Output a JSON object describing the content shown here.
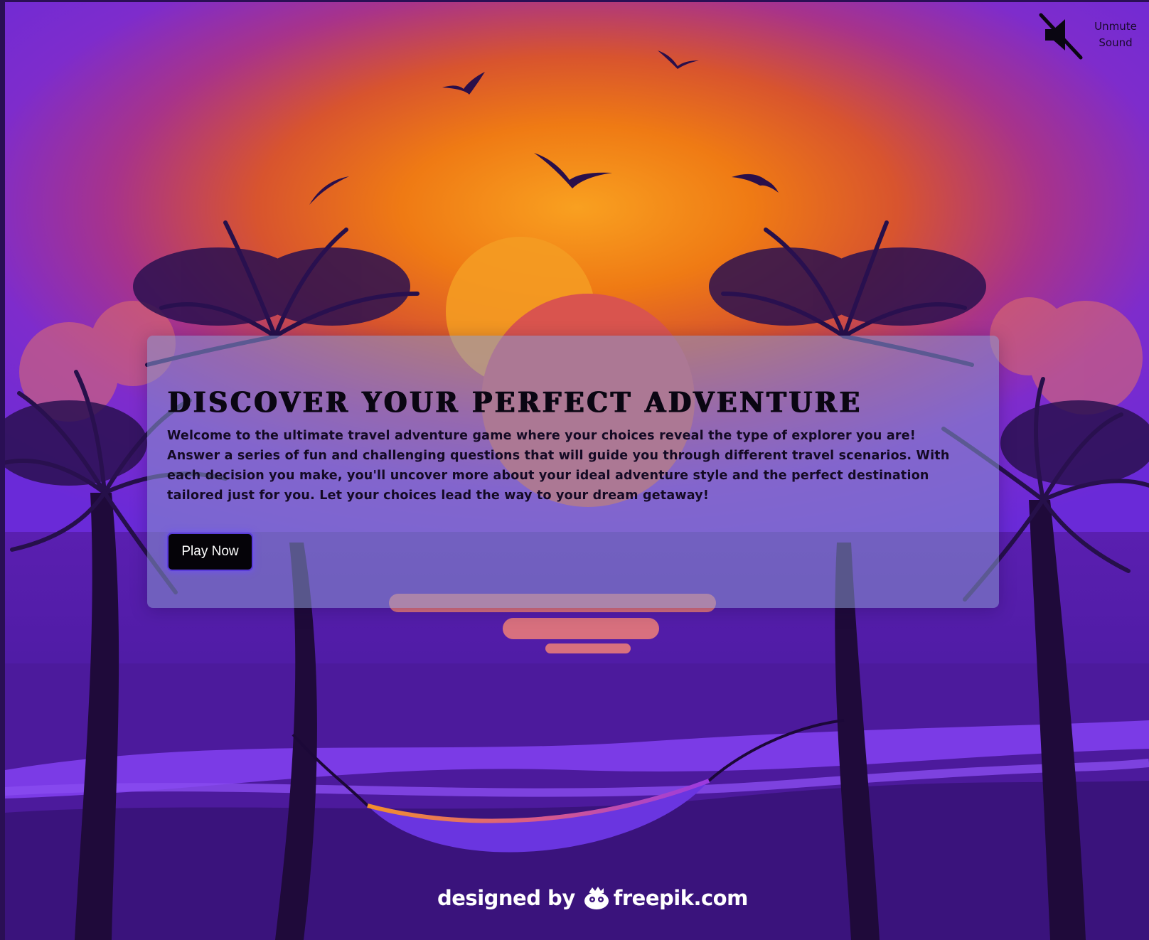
{
  "sound": {
    "label_line1": "Unmute",
    "label_line2": "Sound",
    "icon": "muted-speaker-icon"
  },
  "card": {
    "title": "Discover Your Perfect Adventure",
    "description": "Welcome to the ultimate travel adventure game where your choices reveal the type of explorer you are! Answer a series of fun and challenging questions that will guide you through different travel scenarios. With each decision you make, you'll uncover more about your ideal adventure style and the perfect destination tailored just for you. Let your choices lead the way to your dream getaway!",
    "play_label": "Play Now"
  },
  "credit": {
    "prefix": "designed by",
    "brand": "freepik.com",
    "icon": "freepik-logo-icon"
  },
  "colors": {
    "sky_top": "#7a2fd8",
    "sky_mid": "#e0523a",
    "sun": "#f59a1a",
    "sea": "#5a1fb8",
    "silhouette": "#2a0f4a",
    "button_bg": "#050308",
    "button_glow": "#6e50ff"
  }
}
